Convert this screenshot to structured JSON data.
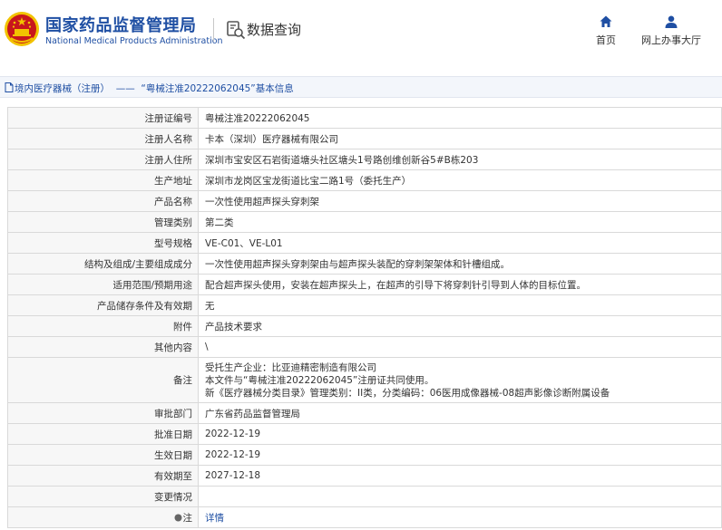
{
  "header": {
    "brand_cn": "国家药品监督管理局",
    "brand_en": "National Medical Products Administration",
    "section_title": "数据查询",
    "nav": [
      {
        "label": "首页",
        "icon": "home-icon"
      },
      {
        "label": "网上办事大厅",
        "icon": "user-icon"
      }
    ]
  },
  "breadcrumb": {
    "category": "境内医疗器械（注册）",
    "separator": "——",
    "record_title": "“粤械注准20222062045”基本信息"
  },
  "details": {
    "rows": [
      {
        "label": "注册证编号",
        "value": "粤械注准20222062045"
      },
      {
        "label": "注册人名称",
        "value": "卡本（深圳）医疗器械有限公司"
      },
      {
        "label": "注册人住所",
        "value": "深圳市宝安区石岩街道塘头社区塘头1号路创维创新谷5#B栋203"
      },
      {
        "label": "生产地址",
        "value": "深圳市龙岗区宝龙街道比宝二路1号（委托生产）"
      },
      {
        "label": "产品名称",
        "value": "一次性使用超声探头穿刺架"
      },
      {
        "label": "管理类别",
        "value": "第二类"
      },
      {
        "label": "型号规格",
        "value": "VE-C01、VE-L01"
      },
      {
        "label": "结构及组成/主要组成成分",
        "value": "一次性使用超声探头穿刺架由与超声探头装配的穿刺架架体和针槽组成。"
      },
      {
        "label": "适用范围/预期用途",
        "value": "配合超声探头使用，安装在超声探头上，在超声的引导下将穿刺针引导到人体的目标位置。"
      },
      {
        "label": "产品储存条件及有效期",
        "value": "无"
      },
      {
        "label": "附件",
        "value": "产品技术要求"
      },
      {
        "label": "其他内容",
        "value": "\\"
      }
    ],
    "remark": {
      "label": "备注",
      "lines": [
        "受托生产企业：比亚迪精密制造有限公司",
        "本文件与“粤械注准20222062045”注册证共同使用。",
        "新《医疗器械分类目录》管理类别：II类，分类编码：06医用成像器械-08超声影像诊断附属设备"
      ]
    },
    "rows_after": [
      {
        "label": "审批部门",
        "value": "广东省药品监督管理局"
      },
      {
        "label": "批准日期",
        "value": "2022-12-19"
      },
      {
        "label": "生效日期",
        "value": "2022-12-19"
      },
      {
        "label": "有效期至",
        "value": "2027-12-18"
      },
      {
        "label": "变更情况",
        "value": ""
      }
    ],
    "note": {
      "label": "注",
      "link": "详情"
    }
  },
  "colors": {
    "brand_blue": "#1f4fa3",
    "label_bg": "#f7f7f7",
    "border": "#d9d9d9",
    "emblem_red": "#c8161d",
    "emblem_gold": "#f2c300"
  }
}
